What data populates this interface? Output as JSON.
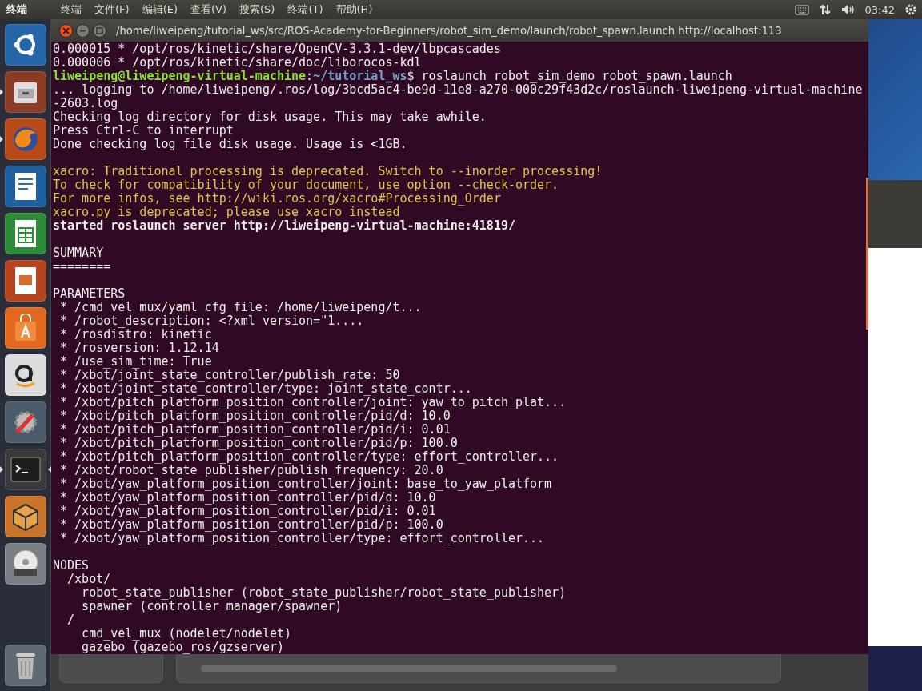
{
  "top_bar": {
    "app_name": "终端",
    "menus": [
      "终端",
      "文件(F)",
      "编辑(E)",
      "查看(V)",
      "搜索(S)",
      "终端(T)",
      "帮助(H)"
    ],
    "time": "03:42"
  },
  "launcher": [
    {
      "running": false,
      "selected": false
    },
    {
      "running": true,
      "selected": false
    },
    {
      "running": true,
      "selected": false
    },
    {
      "running": false,
      "selected": false
    },
    {
      "running": false,
      "selected": false
    },
    {
      "running": false,
      "selected": false
    },
    {
      "running": false,
      "selected": false
    },
    {
      "running": false,
      "selected": false
    },
    {
      "running": false,
      "selected": false
    },
    {
      "running": true,
      "selected": true
    },
    {
      "running": false,
      "selected": false
    },
    {
      "running": false,
      "selected": false
    },
    {
      "running": false,
      "selected": false
    }
  ],
  "window": {
    "title": "/home/liweipeng/tutorial_ws/src/ROS-Academy-for-Beginners/robot_sim_demo/launch/robot_spawn.launch http://localhost:113"
  },
  "terminal": {
    "lines": [
      {
        "kind": "plain",
        "text": "0.000015 * /opt/ros/kinetic/share/OpenCV-3.3.1-dev/lbpcascades"
      },
      {
        "kind": "plain",
        "text": "0.000006 * /opt/ros/kinetic/share/doc/liborocos-kdl"
      },
      {
        "kind": "prompt",
        "user": "liweipeng@liweipeng-virtual-machine",
        "separator": ":",
        "path": "~/tutorial_ws",
        "command": "$ roslaunch robot_sim_demo robot_spawn.launch"
      },
      {
        "kind": "plain",
        "text": "... logging to /home/liweipeng/.ros/log/3bcd5ac4-be9d-11e8-a270-000c29f43d2c/roslaunch-liweipeng-virtual-machine"
      },
      {
        "kind": "plain",
        "text": "-2603.log"
      },
      {
        "kind": "plain",
        "text": "Checking log directory for disk usage. This may take awhile."
      },
      {
        "kind": "plain",
        "text": "Press Ctrl-C to interrupt"
      },
      {
        "kind": "plain",
        "text": "Done checking log file disk usage. Usage is <1GB."
      },
      {
        "kind": "blank"
      },
      {
        "kind": "warning",
        "text": "xacro: Traditional processing is deprecated. Switch to --inorder processing!"
      },
      {
        "kind": "warning",
        "text": "To check for compatibility of your document, use option --check-order."
      },
      {
        "kind": "warning",
        "text": "For more infos, see http://wiki.ros.org/xacro#Processing_Order"
      },
      {
        "kind": "warning",
        "text": "xacro.py is deprecated; please use xacro instead"
      },
      {
        "kind": "bold",
        "text": "started roslaunch server http://liweipeng-virtual-machine:41819/"
      },
      {
        "kind": "blank"
      },
      {
        "kind": "plain",
        "text": "SUMMARY"
      },
      {
        "kind": "plain",
        "text": "========"
      },
      {
        "kind": "blank"
      },
      {
        "kind": "plain",
        "text": "PARAMETERS"
      },
      {
        "kind": "plain",
        "text": " * /cmd_vel_mux/yaml_cfg_file: /home/liweipeng/t..."
      },
      {
        "kind": "plain",
        "text": " * /robot_description: <?xml version=\"1...."
      },
      {
        "kind": "plain",
        "text": " * /rosdistro: kinetic"
      },
      {
        "kind": "plain",
        "text": " * /rosversion: 1.12.14"
      },
      {
        "kind": "plain",
        "text": " * /use_sim_time: True"
      },
      {
        "kind": "plain",
        "text": " * /xbot/joint_state_controller/publish_rate: 50"
      },
      {
        "kind": "plain",
        "text": " * /xbot/joint_state_controller/type: joint_state_contr..."
      },
      {
        "kind": "plain",
        "text": " * /xbot/pitch_platform_position_controller/joint: yaw_to_pitch_plat..."
      },
      {
        "kind": "plain",
        "text": " * /xbot/pitch_platform_position_controller/pid/d: 10.0"
      },
      {
        "kind": "plain",
        "text": " * /xbot/pitch_platform_position_controller/pid/i: 0.01"
      },
      {
        "kind": "plain",
        "text": " * /xbot/pitch_platform_position_controller/pid/p: 100.0"
      },
      {
        "kind": "plain",
        "text": " * /xbot/pitch_platform_position_controller/type: effort_controller..."
      },
      {
        "kind": "plain",
        "text": " * /xbot/robot_state_publisher/publish_frequency: 20.0"
      },
      {
        "kind": "plain",
        "text": " * /xbot/yaw_platform_position_controller/joint: base_to_yaw_platform"
      },
      {
        "kind": "plain",
        "text": " * /xbot/yaw_platform_position_controller/pid/d: 10.0"
      },
      {
        "kind": "plain",
        "text": " * /xbot/yaw_platform_position_controller/pid/i: 0.01"
      },
      {
        "kind": "plain",
        "text": " * /xbot/yaw_platform_position_controller/pid/p: 100.0"
      },
      {
        "kind": "plain",
        "text": " * /xbot/yaw_platform_position_controller/type: effort_controller..."
      },
      {
        "kind": "blank"
      },
      {
        "kind": "plain",
        "text": "NODES"
      },
      {
        "kind": "plain",
        "text": "  /xbot/"
      },
      {
        "kind": "plain",
        "text": "    robot_state_publisher (robot_state_publisher/robot_state_publisher)"
      },
      {
        "kind": "plain",
        "text": "    spawner (controller_manager/spawner)"
      },
      {
        "kind": "plain",
        "text": "  /"
      },
      {
        "kind": "plain",
        "text": "    cmd_vel_mux (nodelet/nodelet)"
      },
      {
        "kind": "plain",
        "text": "    gazebo (gazebo_ros/gzserver)"
      }
    ]
  }
}
